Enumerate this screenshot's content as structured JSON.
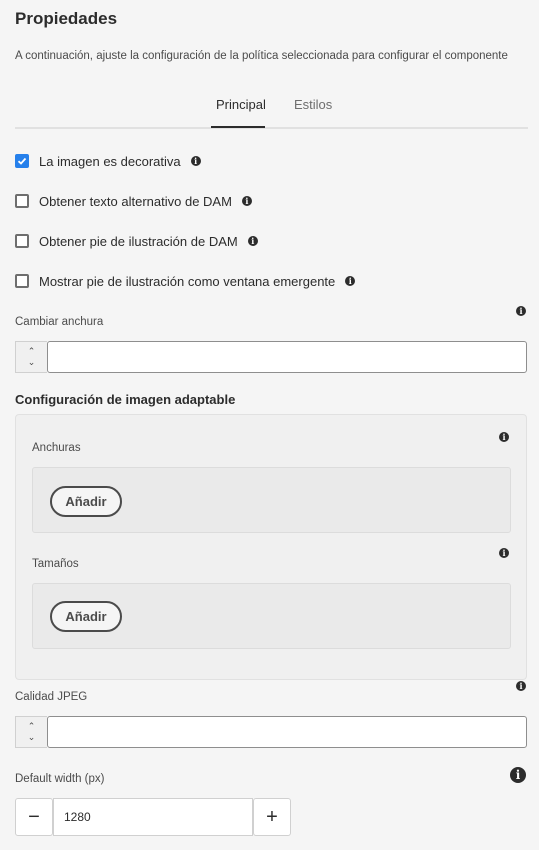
{
  "header": {
    "title": "Propiedades",
    "description": "A continuación, ajuste la configuración de la política seleccionada para configurar el componente"
  },
  "tabs": [
    {
      "label": "Principal",
      "active": true
    },
    {
      "label": "Estilos",
      "active": false
    }
  ],
  "checkboxes": [
    {
      "label": "La imagen es decorativa",
      "checked": true
    },
    {
      "label": "Obtener texto alternativo de DAM",
      "checked": false
    },
    {
      "label": "Obtener pie de ilustración de DAM",
      "checked": false
    },
    {
      "label": "Mostrar pie de ilustración como ventana emergente",
      "checked": false
    }
  ],
  "resize_width": {
    "label": "Cambiar anchura",
    "value": ""
  },
  "adaptive": {
    "title": "Configuración de imagen adaptable",
    "widths_label": "Anchuras",
    "sizes_label": "Tamaños",
    "add_label": "Añadir"
  },
  "jpeg_quality": {
    "label": "Calidad JPEG",
    "value": ""
  },
  "default_width": {
    "label": "Default width (px)",
    "value": "1280"
  },
  "icons": {
    "info": "info-icon",
    "check": "checkmark-icon",
    "up": "chevron-up-icon",
    "down": "chevron-down-icon",
    "minus": "minus-icon",
    "plus": "plus-icon"
  },
  "colors": {
    "accent": "#2680eb",
    "text": "#2c2c2c",
    "background": "#f5f5f5"
  }
}
